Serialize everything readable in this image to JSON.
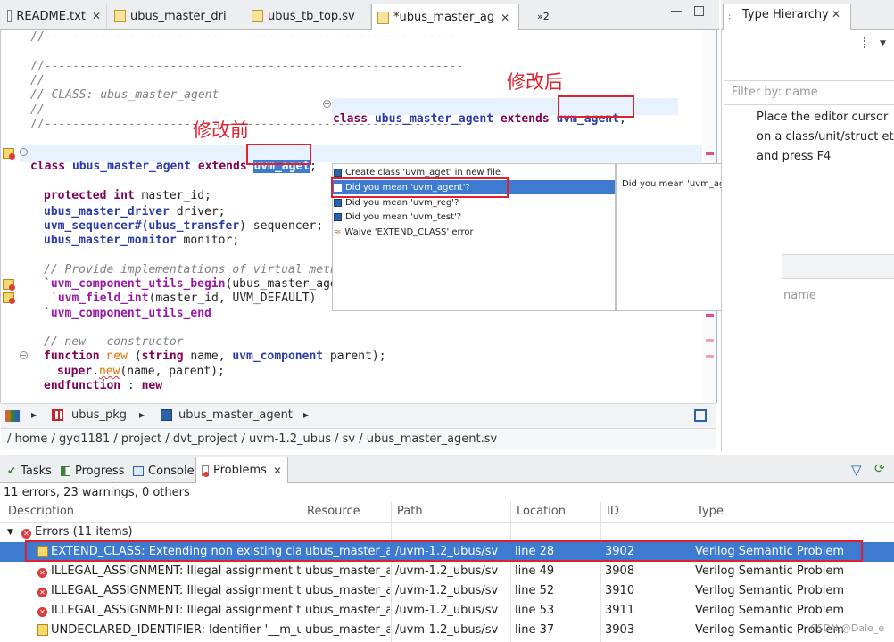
{
  "editor_tabs": [
    {
      "label": "README.txt"
    },
    {
      "label": "ubus_master_dri"
    },
    {
      "label": "ubus_tb_top.sv"
    },
    {
      "label": "*ubus_master_ag"
    },
    {
      "label": "»2"
    }
  ],
  "right_panel": {
    "title": "Type Hierarchy",
    "filter_placeholder": "Filter by: name",
    "hint_lines": [
      "Place the editor cursor",
      "on a class/unit/struct etc.",
      "and press F4"
    ],
    "second_filter_placeholder": "name"
  },
  "annotations": {
    "after": "修改后",
    "before": "修改前"
  },
  "code": {
    "l1": "//------------------------------------------------------------",
    "l2": "//------------------------------------------------------------",
    "l3": "//",
    "l4": "// CLASS: ubus_master_agent",
    "l5": "//",
    "l6": "//------------------------------------------------------------",
    "preview_kw": "class",
    "preview_name": "ubus_master_agent",
    "preview_ext": "extends",
    "preview_base": "uvm_agent",
    "preview_semi": ";",
    "decl_kw": "class",
    "decl_name": "ubus_master_agent",
    "decl_ext": "extends",
    "decl_base": "uvm_aget",
    "decl_semi": ";",
    "protected_kw": "protected",
    "int_kw": "int",
    "protected_rest": " master_id;",
    "driver_type": "ubus_master_driver",
    "driver_rest": " driver;",
    "seq_type": "uvm_sequencer#(",
    "seq_param": "ubus_transfer",
    "seq_rest": ") sequencer;",
    "mon_type": "ubus_master_monitor",
    "mon_rest": " monitor;",
    "cm_provide": "// Provide implementations of virtual metho",
    "macro_begin": "`uvm_component_utils_begin",
    "macro_begin_rest": "(ubus_master_ager",
    "macro_field": "`uvm_field_int",
    "macro_field_rest": "(master_id, UVM_DEFAULT)",
    "macro_end": "`uvm_component_utils_end",
    "cm_new": "// new - constructor",
    "fn_kw": "function",
    "fn_new": "new",
    "fn_mid": " (",
    "fn_string": "string",
    "fn_mid2": " name, ",
    "fn_comp": "uvm_component",
    "fn_rest": " parent);",
    "super_kw": "super",
    "super_dot": ".",
    "super_new": "new",
    "super_rest": "(name, parent);",
    "endfn_kw": "endfunction",
    "endfn_rest": " : ",
    "endfn_new": "new"
  },
  "quick_fix": {
    "items": [
      "Create class 'uvm_aget' in new file",
      "Did you mean 'uvm_agent'?",
      "Did you mean 'uvm_reg'?",
      "Did you mean 'uvm_test'?",
      "Waive 'EXTEND_CLASS' error"
    ],
    "selected_index": 1,
    "detail": "Did you mean 'uvm_agent'?"
  },
  "breadcrumb": {
    "pkg": "ubus_pkg",
    "class": "ubus_master_agent"
  },
  "path_bar": "/ home / gyd1181 / project / dvt_project / uvm-1.2_ubus / sv / ubus_master_agent.sv",
  "bottom_tabs": [
    {
      "label": "Tasks"
    },
    {
      "label": "Progress"
    },
    {
      "label": "Console"
    },
    {
      "label": "Problems"
    }
  ],
  "problems": {
    "summary": "11 errors, 23 warnings, 0 others",
    "columns": [
      "Description",
      "Resource",
      "Path",
      "Location",
      "ID",
      "Type"
    ],
    "group": "Errors (11 items)",
    "rows": [
      {
        "desc": "EXTEND_CLASS: Extending non existing class",
        "res": "ubus_master_a",
        "path": "/uvm-1.2_ubus/sv",
        "loc": "line 28",
        "id": "3902",
        "type": "Verilog Semantic Problem"
      },
      {
        "desc": "ILLEGAL_ASSIGNMENT: Illegal assignment to",
        "res": "ubus_master_a",
        "path": "/uvm-1.2_ubus/sv",
        "loc": "line 49",
        "id": "3908",
        "type": "Verilog Semantic Problem"
      },
      {
        "desc": "ILLEGAL_ASSIGNMENT: Illegal assignment to",
        "res": "ubus_master_a",
        "path": "/uvm-1.2_ubus/sv",
        "loc": "line 52",
        "id": "3910",
        "type": "Verilog Semantic Problem"
      },
      {
        "desc": "ILLEGAL_ASSIGNMENT: Illegal assignment to",
        "res": "ubus_master_a",
        "path": "/uvm-1.2_ubus/sv",
        "loc": "line 53",
        "id": "3911",
        "type": "Verilog Semantic Problem"
      },
      {
        "desc": "UNDECLARED_IDENTIFIER: Identifier '__m_uv",
        "res": "ubus_master_a",
        "path": "/uvm-1.2_ubus/sv",
        "loc": "line 37",
        "id": "3903",
        "type": "Verilog Semantic Problem"
      }
    ]
  },
  "watermark": "CSDN @Dale_e",
  "colors": {
    "highlight_border": "#e0202f",
    "selection": "#3d7bd0",
    "annotation": "#e0202f"
  }
}
